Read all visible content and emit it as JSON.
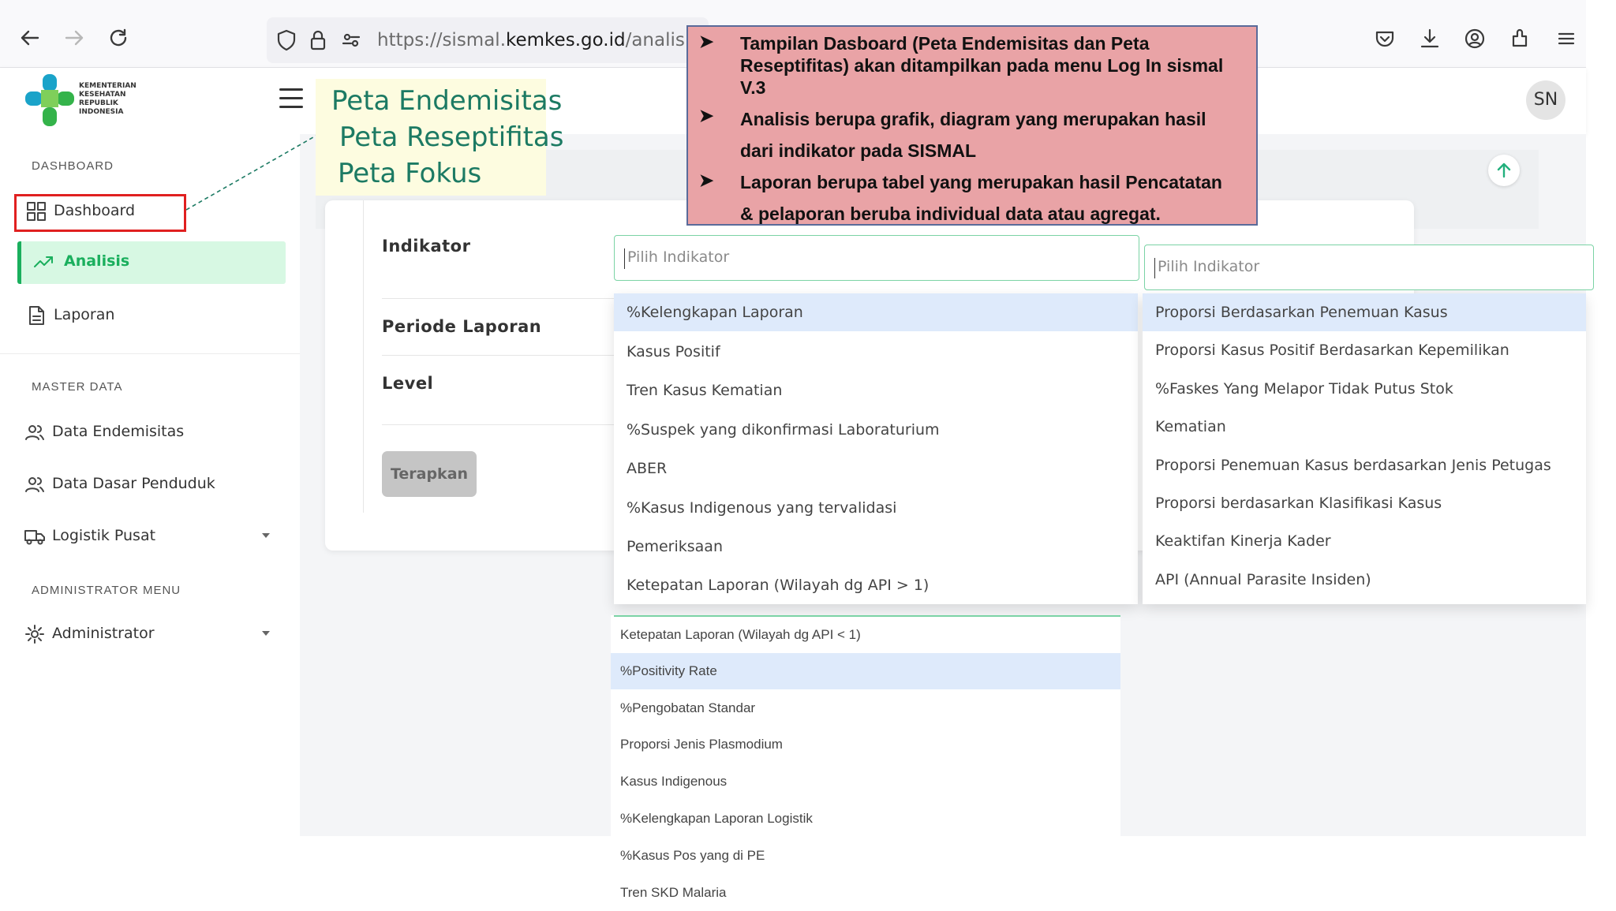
{
  "browser": {
    "url_prefix": "https://sismal.",
    "url_host": "kemkes.go.id",
    "url_path": "/analisis"
  },
  "header": {
    "logo_text": "KEMENTERIAN KESEHATAN REPUBLIK INDONESIA",
    "avatar_initials": "SN"
  },
  "sidebar": {
    "section_dashboard": "DASHBOARD",
    "dashboard_label": "Dashboard",
    "analisis_label": "Analisis",
    "laporan_label": "Laporan",
    "section_master": "MASTER DATA",
    "data_endemisitas": "Data Endemisitas",
    "data_dasar_penduduk": "Data Dasar Penduduk",
    "logistik_pusat": "Logistik Pusat",
    "section_admin": "ADMINISTRATOR MENU",
    "administrator": "Administrator"
  },
  "form": {
    "indikator_label": "Indikator",
    "periode_label": "Periode Laporan",
    "level_label": "Level",
    "apply_button": "Terapkan",
    "select_placeholder": "Pilih Indikator"
  },
  "dropdown_left": [
    "%Kelengkapan Laporan",
    "Kasus Positif",
    "Tren Kasus Kematian",
    "%Suspek yang dikonfirmasi Laboraturium",
    "ABER",
    "%Kasus Indigenous yang tervalidasi",
    "Pemeriksaan",
    "Ketepatan Laporan (Wilayah dg API > 1)"
  ],
  "dropdown_right": [
    "Proporsi Berdasarkan Penemuan Kasus",
    "Proporsi Kasus Positif Berdasarkan Kepemilikan",
    "%Faskes Yang Melapor Tidak Putus Stok",
    "Kematian",
    "Proporsi Penemuan Kasus berdasarkan Jenis Petugas",
    "Proporsi berdasarkan Klasifikasi Kasus",
    "Keaktifan Kinerja Kader",
    "API (Annual Parasite Insiden)"
  ],
  "dropdown_bottom": [
    "Ketepatan Laporan (Wilayah dg API < 1)",
    "%Positivity Rate",
    "%Pengobatan Standar",
    "Proporsi Jenis Plasmodium",
    "Kasus Indigenous",
    "%Kelengkapan Laporan Logistik",
    "%Kasus Pos yang di PE",
    "Tren SKD Malaria"
  ],
  "annotation_yellow": {
    "line1": "Peta Endemisitas",
    "line2": "Peta Reseptifitas",
    "line3": "Peta Fokus"
  },
  "annotation_red": {
    "b1_l1": "Tampilan Dasboard   (Peta Endemisitas  dan Peta",
    "b1_l2": "Reseptifitas) akan  ditampilkan pada  menu Log In sismal",
    "b1_l3": "V.3",
    "b2_l1": "Analisis berupa grafik,  diagram  yang merupakan  hasil",
    "b2_l2": "dari indikator  pada SISMAL",
    "b3_l1": "Laporan   berupa tabel yang merupakan  hasil Pencatatan",
    "b3_l2": "&  pelaporan beruba  individual  data  atau agregat."
  },
  "colors": {
    "accent_green": "#1aaf5d",
    "highlight_blue": "#deeafb",
    "annotation_red_bg": "#e9a3a6",
    "annotation_yellow_bg": "#fdfce0",
    "annotation_text_teal": "#1c7a63"
  }
}
